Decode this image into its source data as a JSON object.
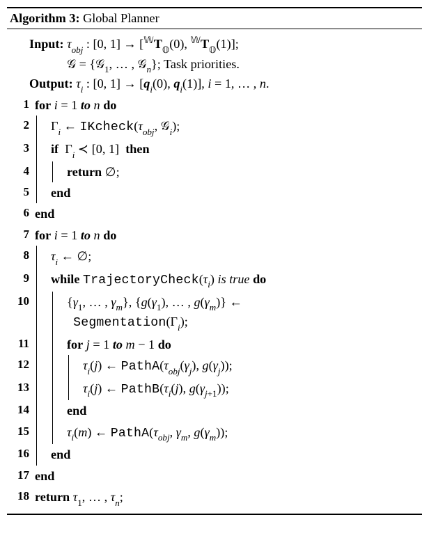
{
  "header": {
    "label": "Algorithm 3:",
    "title": "Global Planner"
  },
  "io": {
    "input_label": "Input:",
    "input_line1": "τ_obj : [0, 1] → [ ᵂT_𝕆(0), ᵂT_𝕆(1) ];",
    "input_line2": "𝒢 = {𝒢₁, …, 𝒢ₙ}; Task priorities.",
    "output_label": "Output:",
    "output_line": "τᵢ : [0, 1] → [qᵢ(0), qᵢ(1)], i = 1, …, n."
  },
  "lines": {
    "l1": "for i = 1 to n do",
    "l2": "Γᵢ ← IKcheck(τ_obj, 𝒢ᵢ);",
    "l3": "if  Γᵢ ≺ [0, 1]  then",
    "l4": "return ∅;",
    "l5": "end",
    "l6": "end",
    "l7": "for i = 1 to n do",
    "l8": "τᵢ ← ∅;",
    "l9": "while TrajectoryCheck(τᵢ) is true do",
    "l10": "{γ₁, …, γₘ}, {g(γ₁), …, g(γₘ)} ←",
    "l10b": "Segmentation(Γᵢ);",
    "l11": "for j = 1 to m − 1 do",
    "l12": "τᵢ(j) ← PathA(τ_obj(γⱼ), g(γⱼ));",
    "l13": "τᵢ(j) ← PathB(τᵢ(j), g(γⱼ₊₁));",
    "l14": "end",
    "l15": "τᵢ(m) ← PathA(τ_obj, γₘ, g(γₘ));",
    "l16": "end",
    "l17": "end",
    "l18": "return τ₁, …, τₙ;"
  },
  "kw": {
    "for": "for",
    "to": "to",
    "do": "do",
    "if": "if",
    "then": "then",
    "return": "return",
    "end": "end",
    "while": "while",
    "is_true": "is true"
  },
  "fn": {
    "ikcheck": "IKcheck",
    "trajcheck": "TrajectoryCheck",
    "seg": "Segmentation",
    "pathA": "PathA",
    "pathB": "PathB"
  }
}
